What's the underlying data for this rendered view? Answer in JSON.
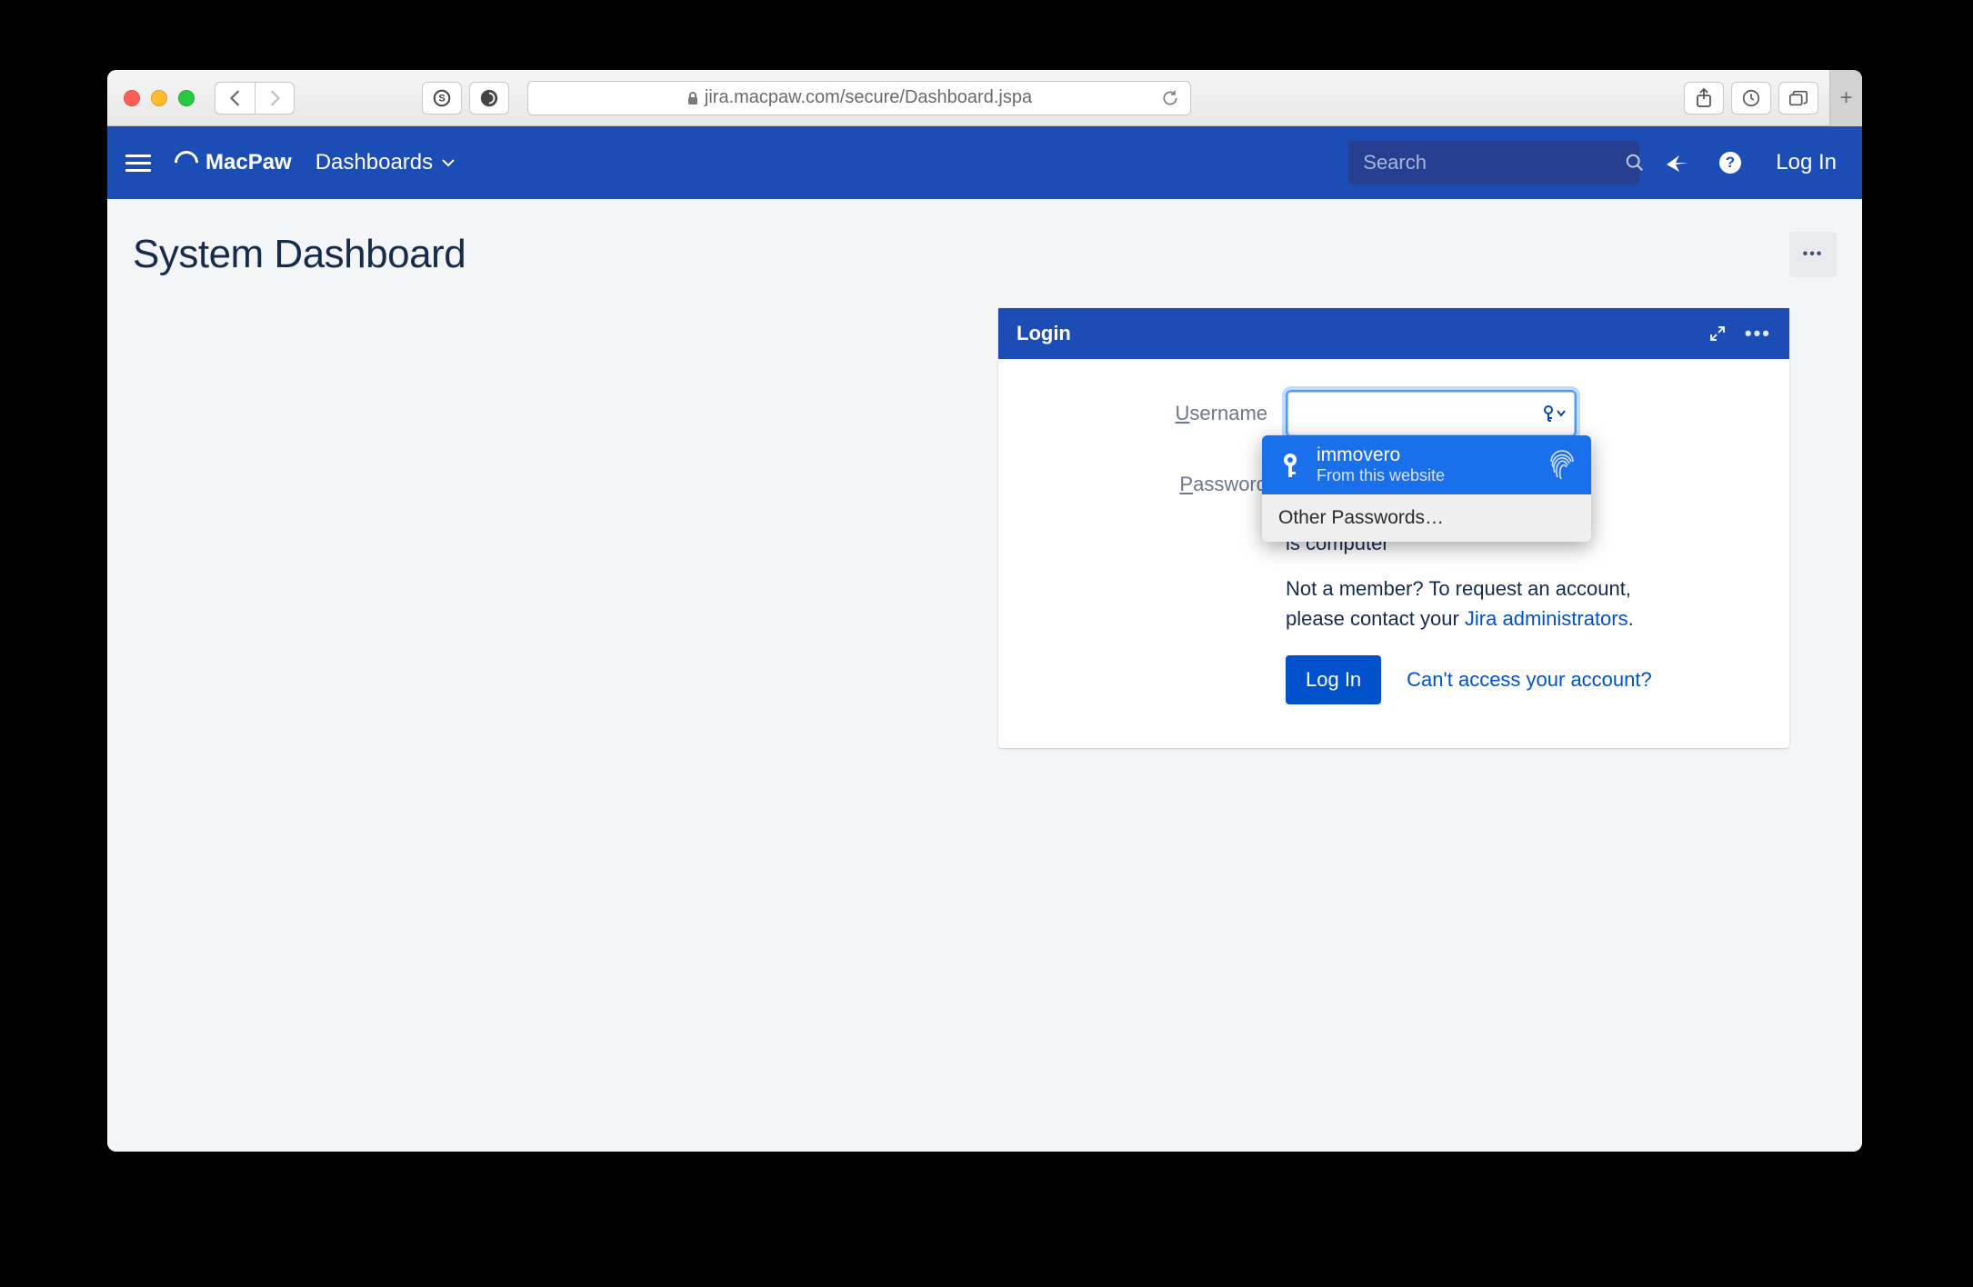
{
  "browser": {
    "url": "jira.macpaw.com/secure/Dashboard.jspa"
  },
  "nav": {
    "brand": "MacPaw",
    "dashboards": "Dashboards",
    "search_placeholder": "Search",
    "login": "Log In"
  },
  "page": {
    "title": "System Dashboard"
  },
  "gadget": {
    "title": "Login",
    "username_label_u": "U",
    "username_label_rest": "sername",
    "password_label_p": "P",
    "password_label_rest": "assword",
    "remember_text_tail": "is computer",
    "member_line1": "Not a member? To request an account,",
    "member_line2_pre": "please contact your ",
    "member_link": "Jira administrators",
    "member_line2_post": ".",
    "login_button": "Log In",
    "cant_access": "Can't access your account?"
  },
  "autofill": {
    "username": "immovero",
    "subtitle": "From this website",
    "other": "Other Passwords…"
  }
}
